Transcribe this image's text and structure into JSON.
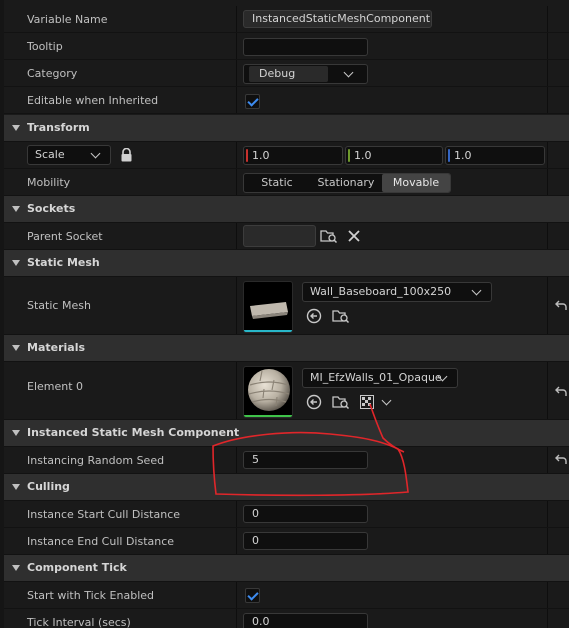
{
  "rows": {
    "variable_name": {
      "label": "Variable Name",
      "value": "InstancedStaticMeshComponent"
    },
    "tooltip": {
      "label": "Tooltip",
      "value": ""
    },
    "category": {
      "label": "Category",
      "value": "Debug"
    },
    "editable": {
      "label": "Editable when Inherited",
      "checked": true
    }
  },
  "transform": {
    "title": "Transform",
    "scale_label": "Scale",
    "x": "1.0",
    "y": "1.0",
    "z": "1.0",
    "mobility_label": "Mobility",
    "mobility_options": [
      "Static",
      "Stationary",
      "Movable"
    ],
    "mobility_selected": "Movable"
  },
  "sockets": {
    "title": "Sockets",
    "parent_label": "Parent Socket",
    "parent_value": ""
  },
  "static_mesh": {
    "title": "Static Mesh",
    "label": "Static Mesh",
    "value": "Wall_Baseboard_100x250"
  },
  "materials": {
    "title": "Materials",
    "label": "Element 0",
    "value": "MI_EfzWalls_01_Opaque"
  },
  "ismc": {
    "title": "Instanced Static Mesh Component",
    "seed_label": "Instancing Random Seed",
    "seed_value": "5"
  },
  "culling": {
    "title": "Culling",
    "start_label": "Instance Start Cull Distance",
    "start_value": "0",
    "end_label": "Instance End Cull Distance",
    "end_value": "0"
  },
  "tick": {
    "title": "Component Tick",
    "start_label": "Start with Tick Enabled",
    "start_checked": true,
    "interval_label": "Tick Interval (secs)",
    "interval_value": "0.0"
  },
  "colors": {
    "accent": "#3e8cf0",
    "annotation": "#e0262a",
    "x_axis": "#c8312d",
    "y_axis": "#6f9a2d",
    "z_axis": "#3466c4"
  }
}
